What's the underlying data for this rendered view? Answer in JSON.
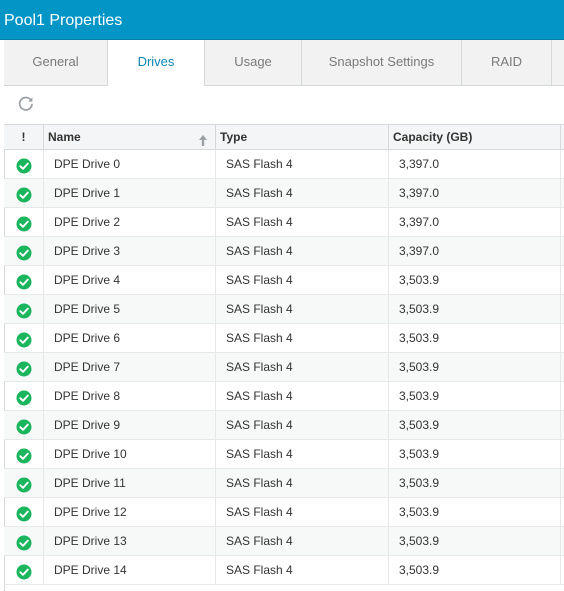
{
  "window": {
    "title": "Pool1 Properties"
  },
  "tabs": [
    {
      "label": "General"
    },
    {
      "label": "Drives"
    },
    {
      "label": "Usage"
    },
    {
      "label": "Snapshot Settings"
    },
    {
      "label": "RAID"
    }
  ],
  "active_tab": "Drives",
  "toolbar": {
    "refresh_icon": "refresh-icon"
  },
  "table": {
    "columns": [
      {
        "label": "!"
      },
      {
        "label": "Name",
        "sorted": "ascending"
      },
      {
        "label": "Type"
      },
      {
        "label": "Capacity (GB)"
      }
    ],
    "rows": [
      {
        "status": "ok",
        "name": "DPE Drive 0",
        "type": "SAS Flash 4",
        "capacity": "3,397.0"
      },
      {
        "status": "ok",
        "name": "DPE Drive 1",
        "type": "SAS Flash 4",
        "capacity": "3,397.0"
      },
      {
        "status": "ok",
        "name": "DPE Drive 2",
        "type": "SAS Flash 4",
        "capacity": "3,397.0"
      },
      {
        "status": "ok",
        "name": "DPE Drive 3",
        "type": "SAS Flash 4",
        "capacity": "3,397.0"
      },
      {
        "status": "ok",
        "name": "DPE Drive 4",
        "type": "SAS Flash 4",
        "capacity": "3,503.9"
      },
      {
        "status": "ok",
        "name": "DPE Drive 5",
        "type": "SAS Flash 4",
        "capacity": "3,503.9"
      },
      {
        "status": "ok",
        "name": "DPE Drive 6",
        "type": "SAS Flash 4",
        "capacity": "3,503.9"
      },
      {
        "status": "ok",
        "name": "DPE Drive 7",
        "type": "SAS Flash 4",
        "capacity": "3,503.9"
      },
      {
        "status": "ok",
        "name": "DPE Drive 8",
        "type": "SAS Flash 4",
        "capacity": "3,503.9"
      },
      {
        "status": "ok",
        "name": "DPE Drive 9",
        "type": "SAS Flash 4",
        "capacity": "3,503.9"
      },
      {
        "status": "ok",
        "name": "DPE Drive 10",
        "type": "SAS Flash 4",
        "capacity": "3,503.9"
      },
      {
        "status": "ok",
        "name": "DPE Drive 11",
        "type": "SAS Flash 4",
        "capacity": "3,503.9"
      },
      {
        "status": "ok",
        "name": "DPE Drive 12",
        "type": "SAS Flash 4",
        "capacity": "3,503.9"
      },
      {
        "status": "ok",
        "name": "DPE Drive 13",
        "type": "SAS Flash 4",
        "capacity": "3,503.9"
      },
      {
        "status": "ok",
        "name": "DPE Drive 14",
        "type": "SAS Flash 4",
        "capacity": "3,503.9"
      }
    ]
  },
  "colors": {
    "title_bar": "#0295c5",
    "active_tab_text": "#0a86b5",
    "status_ok": "#1ab55c"
  }
}
